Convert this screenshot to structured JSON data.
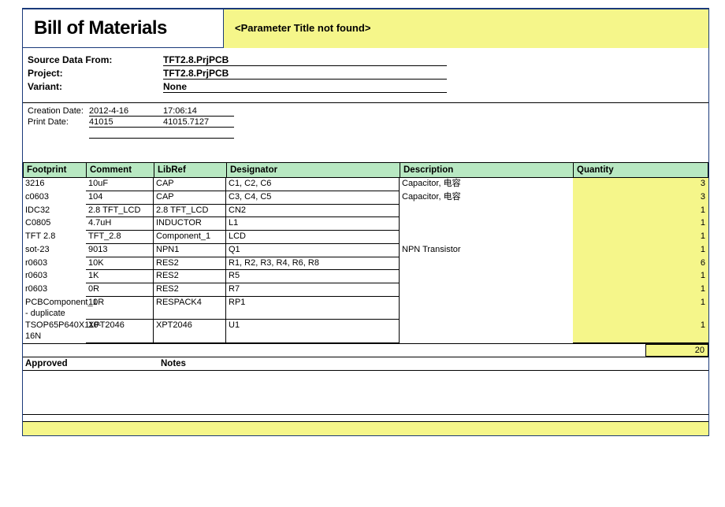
{
  "title": "Bill of Materials",
  "param_title": "<Parameter Title not found>",
  "meta": {
    "source_label": "Source Data From:",
    "source_value": "TFT2.8.PrjPCB",
    "project_label": "Project:",
    "project_value": "TFT2.8.PrjPCB",
    "variant_label": "Variant:",
    "variant_value": "None"
  },
  "dates": {
    "creation_label": "Creation Date:",
    "creation_date": "2012-4-16",
    "creation_time": "17:06:14",
    "print_label": "Print Date:",
    "print_date": "41015",
    "print_time": "41015.7127"
  },
  "headers": {
    "footprint": "Footprint",
    "comment": "Comment",
    "libref": "LibRef",
    "designator": "Designator",
    "description": "Description",
    "quantity": "Quantity"
  },
  "rows": [
    {
      "footprint": "3216",
      "comment": "10uF",
      "libref": "CAP",
      "designator": "C1, C2, C6",
      "description": "Capacitor,  电容",
      "quantity": "3"
    },
    {
      "footprint": "c0603",
      "comment": "104",
      "libref": "CAP",
      "designator": "C3, C4, C5",
      "description": "Capacitor,  电容",
      "quantity": "3"
    },
    {
      "footprint": "IDC32",
      "comment": "2.8 TFT_LCD",
      "libref": "2.8 TFT_LCD",
      "designator": "CN2",
      "description": "",
      "quantity": "1"
    },
    {
      "footprint": "C0805",
      "comment": "4.7uH",
      "libref": "INDUCTOR",
      "designator": "L1",
      "description": "",
      "quantity": "1"
    },
    {
      "footprint": "TFT 2.8",
      "comment": "TFT_2.8",
      "libref": "Component_1",
      "designator": "LCD",
      "description": "",
      "quantity": "1"
    },
    {
      "footprint": "sot-23",
      "comment": "9013",
      "libref": "NPN1",
      "designator": "Q1",
      "description": "NPN Transistor",
      "quantity": "1"
    },
    {
      "footprint": "r0603",
      "comment": "10K",
      "libref": "RES2",
      "designator": "R1, R2, R3, R4, R6, R8",
      "description": "",
      "quantity": "6"
    },
    {
      "footprint": "r0603",
      "comment": "1K",
      "libref": "RES2",
      "designator": "R5",
      "description": "",
      "quantity": "1"
    },
    {
      "footprint": "r0603",
      "comment": "0R",
      "libref": "RES2",
      "designator": "R7",
      "description": "",
      "quantity": "1"
    },
    {
      "footprint": "PCBComponent_1 - duplicate",
      "comment": "10R",
      "libref": "RESPACK4",
      "designator": "RP1",
      "description": "",
      "quantity": "1"
    },
    {
      "footprint": "TSOP65P640X110-16N",
      "comment": "XPT2046",
      "libref": "XPT2046",
      "designator": "U1",
      "description": "",
      "quantity": "1"
    }
  ],
  "total": "20",
  "approved_label": "Approved",
  "notes_label": "Notes"
}
